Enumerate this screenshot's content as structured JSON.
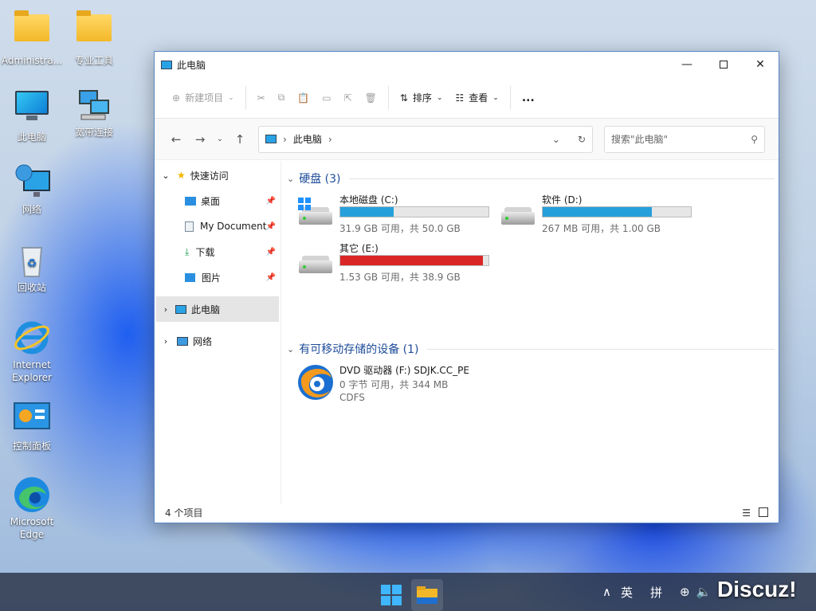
{
  "desktop": {
    "icons": [
      {
        "label": "Administra...",
        "icon": "folder-icon"
      },
      {
        "label": "专业工具",
        "icon": "folder-icon"
      },
      {
        "label": "此电脑",
        "icon": "computer-icon"
      },
      {
        "label": "宽带连接",
        "icon": "network-connection-icon"
      },
      {
        "label": "网络",
        "icon": "network-globe-icon"
      },
      {
        "label": "回收站",
        "icon": "recycle-bin-icon"
      },
      {
        "label": "Internet Explorer",
        "icon": "internet-explorer-icon"
      },
      {
        "label": "控制面板",
        "icon": "control-panel-icon"
      },
      {
        "label": "Microsoft Edge",
        "icon": "edge-icon"
      }
    ]
  },
  "window": {
    "title": "此电脑",
    "toolbar": {
      "new_item": "新建项目",
      "sort": "排序",
      "view": "查看",
      "more": "..."
    },
    "address": {
      "path": "此电脑",
      "search_placeholder": "搜索\"此电脑\""
    },
    "nav": {
      "quick_access": "快速访问",
      "items": [
        "桌面",
        "My Document",
        "下载",
        "图片"
      ],
      "this_pc": "此电脑",
      "network": "网络"
    },
    "groups": {
      "drives": "硬盘 (3)",
      "removable": "有可移动存储的设备 (1)"
    },
    "drives": [
      {
        "name": "本地磁盘 (C:)",
        "info": "31.9 GB 可用，共 50.0 GB",
        "used_fraction": 0.362,
        "color": "#26a0da"
      },
      {
        "name": "软件 (D:)",
        "info": "267 MB 可用，共 1.00 GB",
        "used_fraction": 0.739,
        "color": "#26a0da"
      },
      {
        "name": "其它 (E:)",
        "info": "1.53 GB 可用，共 38.9 GB",
        "used_fraction": 0.961,
        "color": "#da2626"
      }
    ],
    "dvd": {
      "name": "DVD 驱动器 (F:) SDJK.CC_PE",
      "info": "0 字节 可用，共 344 MB",
      "fs": "CDFS"
    },
    "status": "4 个项目"
  },
  "taskbar": {
    "lang": "英",
    "ime": "拼",
    "watermark": "Discuz!"
  }
}
